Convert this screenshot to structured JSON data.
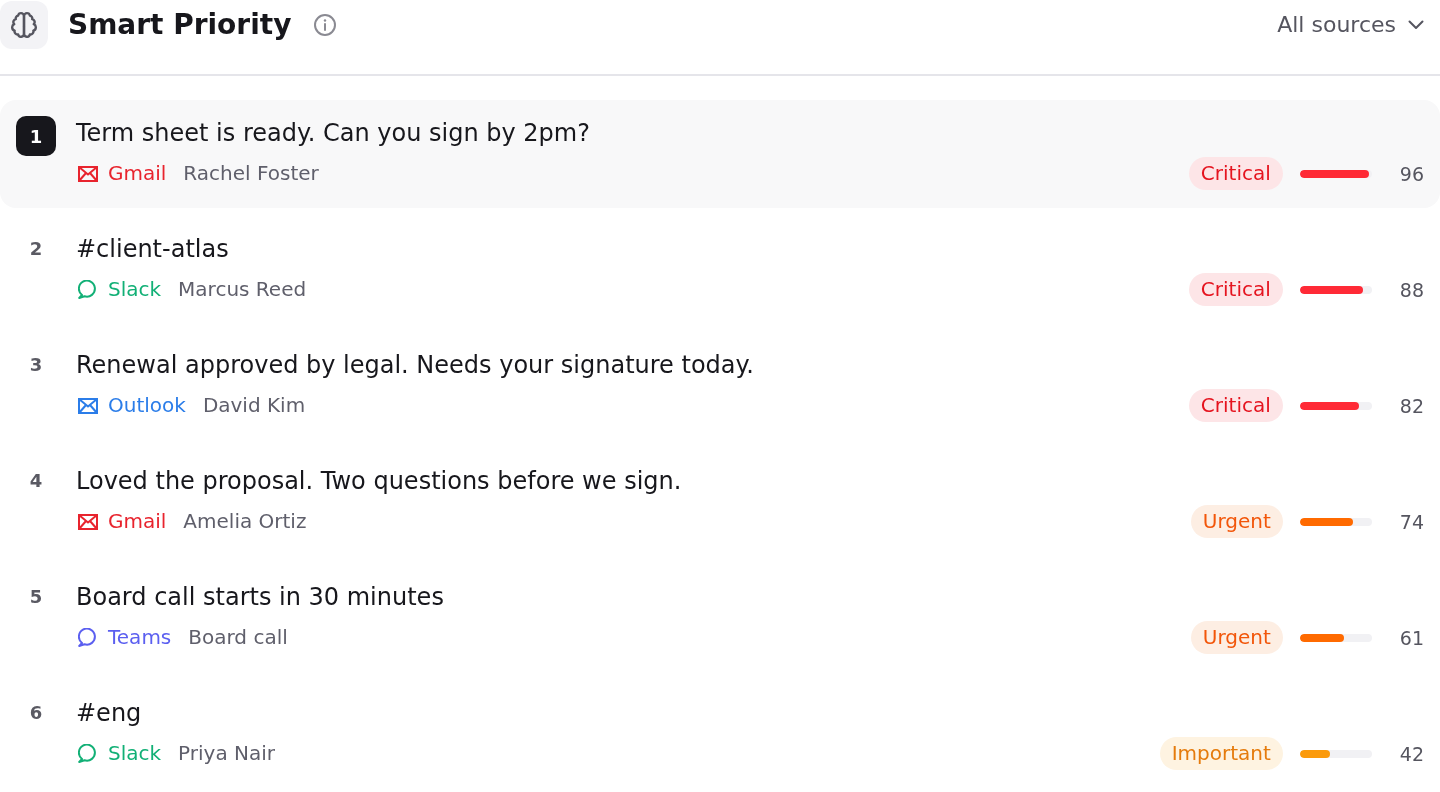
{
  "header": {
    "title": "Smart Priority",
    "filter": {
      "label": "All sources"
    }
  },
  "rows": [
    {
      "rank": "1",
      "selected": true,
      "title": "Term sheet is ready. Can you sign by 2pm?",
      "source": {
        "name": "Gmail",
        "kind": "mail",
        "color": "#e8242e"
      },
      "sender": "Rachel Foster",
      "priority": {
        "label": "Critical",
        "kind": "critical"
      },
      "level": 0.96,
      "score": "96"
    },
    {
      "rank": "2",
      "selected": false,
      "title": "#client-atlas",
      "source": {
        "name": "Slack",
        "kind": "chat",
        "color": "#12b076"
      },
      "sender": "Marcus Reed",
      "priority": {
        "label": "Critical",
        "kind": "critical"
      },
      "level": 0.88,
      "score": "88"
    },
    {
      "rank": "3",
      "selected": false,
      "title": "Renewal approved by legal. Needs your signature today.",
      "source": {
        "name": "Outlook",
        "kind": "mail",
        "color": "#2b7de9"
      },
      "sender": "David Kim",
      "priority": {
        "label": "Critical",
        "kind": "critical"
      },
      "level": 0.82,
      "score": "82"
    },
    {
      "rank": "4",
      "selected": false,
      "title": "Loved the proposal. Two questions before we sign.",
      "source": {
        "name": "Gmail",
        "kind": "mail",
        "color": "#e8242e"
      },
      "sender": "Amelia Ortiz",
      "priority": {
        "label": "Urgent",
        "kind": "urgent"
      },
      "level": 0.74,
      "score": "74"
    },
    {
      "rank": "5",
      "selected": false,
      "title": "Board call starts in 30 minutes",
      "source": {
        "name": "Teams",
        "kind": "chat",
        "color": "#5b5ff0"
      },
      "sender": "Board call",
      "priority": {
        "label": "Urgent",
        "kind": "urgent"
      },
      "level": 0.61,
      "score": "61"
    },
    {
      "rank": "6",
      "selected": false,
      "title": "#eng",
      "source": {
        "name": "Slack",
        "kind": "chat",
        "color": "#12b076"
      },
      "sender": "Priya Nair",
      "priority": {
        "label": "Important",
        "kind": "important"
      },
      "level": 0.42,
      "score": "42"
    }
  ]
}
